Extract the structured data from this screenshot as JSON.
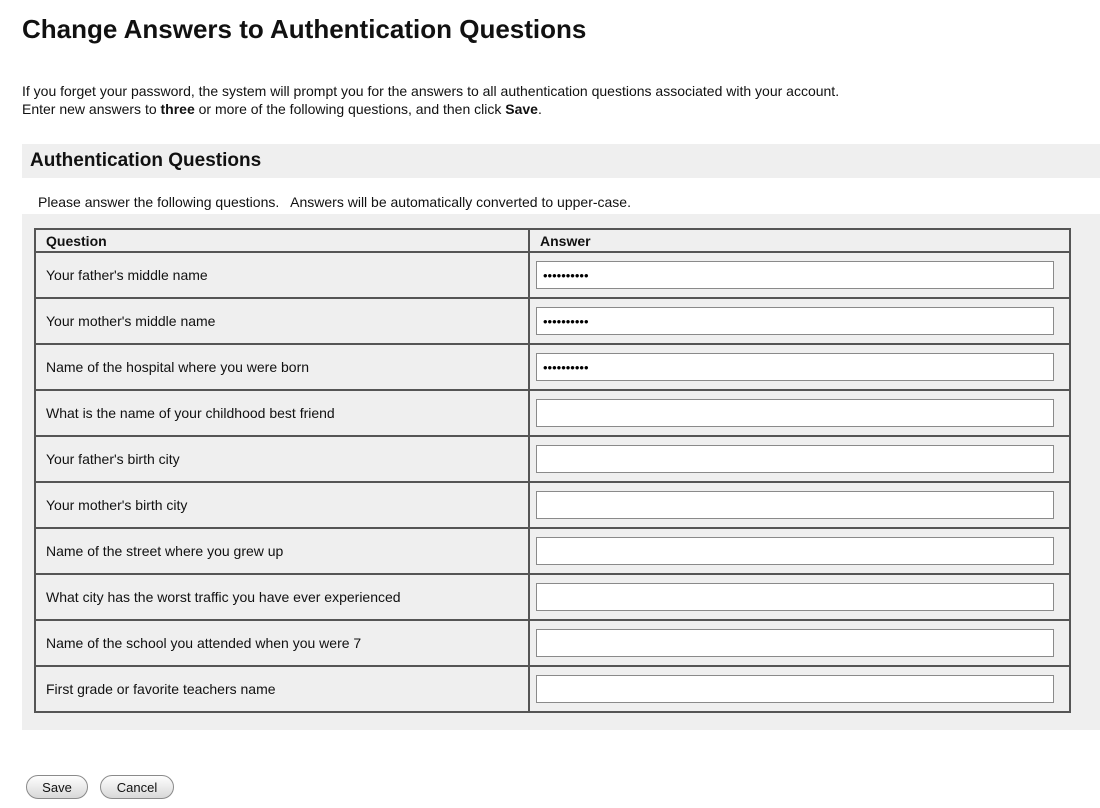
{
  "page": {
    "title": "Change Answers to Authentication Questions",
    "intro_line1": "If you forget your password, the system will prompt you for the answers to all authentication questions associated with your account.",
    "intro_line2_pre": "Enter new answers to ",
    "intro_line2_bold": "three",
    "intro_line2_mid": " or more of the following questions, and then click ",
    "intro_line2_bold2": "Save",
    "intro_line2_end": "."
  },
  "section": {
    "heading": "Authentication Questions",
    "hint": "Please answer the following questions.   Answers will be automatically converted to upper-case."
  },
  "table": {
    "headers": {
      "question": "Question",
      "answer": "Answer"
    },
    "rows": [
      {
        "question": "Your father's middle name",
        "answer": "••••••••••"
      },
      {
        "question": "Your mother's middle name",
        "answer": "••••••••••"
      },
      {
        "question": "Name of the hospital where you were born",
        "answer": "••••••••••"
      },
      {
        "question": "What is the name of your childhood best friend",
        "answer": ""
      },
      {
        "question": "Your father's birth city",
        "answer": ""
      },
      {
        "question": "Your mother's birth city",
        "answer": ""
      },
      {
        "question": "Name of the street where you grew up",
        "answer": ""
      },
      {
        "question": "What city has the worst traffic you have ever experienced",
        "answer": ""
      },
      {
        "question": "Name of the school you attended when you were 7",
        "answer": ""
      },
      {
        "question": "First grade or favorite teachers name",
        "answer": ""
      }
    ]
  },
  "buttons": {
    "save": "Save",
    "cancel": "Cancel"
  }
}
